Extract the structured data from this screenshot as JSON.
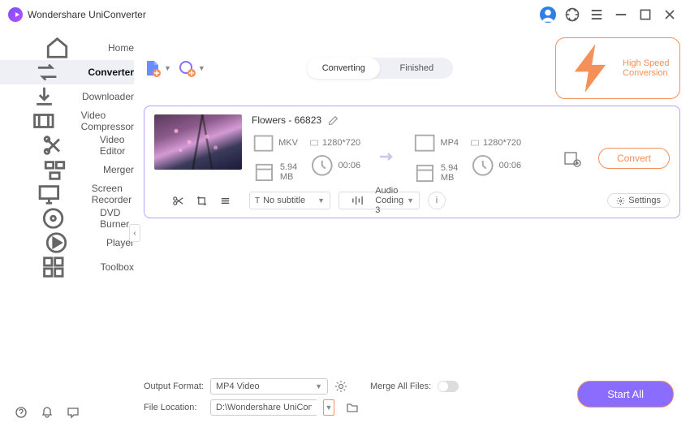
{
  "app": {
    "title": "Wondershare UniConverter"
  },
  "sidebar": {
    "items": [
      {
        "label": "Home",
        "name": "home"
      },
      {
        "label": "Converter",
        "name": "converter"
      },
      {
        "label": "Downloader",
        "name": "downloader"
      },
      {
        "label": "Video Compressor",
        "name": "video-compressor"
      },
      {
        "label": "Video Editor",
        "name": "video-editor"
      },
      {
        "label": "Merger",
        "name": "merger"
      },
      {
        "label": "Screen Recorder",
        "name": "screen-recorder"
      },
      {
        "label": "DVD Burner",
        "name": "dvd-burner"
      },
      {
        "label": "Player",
        "name": "player"
      },
      {
        "label": "Toolbox",
        "name": "toolbox"
      }
    ]
  },
  "tabs": {
    "converting": "Converting",
    "finished": "Finished"
  },
  "speed": "High Speed Conversion",
  "file": {
    "name": "Flowers - 66823",
    "src": {
      "format": "MKV",
      "res": "1280*720",
      "size": "5.94 MB",
      "dur": "00:06"
    },
    "dst": {
      "format": "MP4",
      "res": "1280*720",
      "size": "5.94 MB",
      "dur": "00:06"
    },
    "convert": "Convert",
    "subtitle": "No subtitle",
    "audio": "Audio Coding 3",
    "settings": "Settings"
  },
  "footer": {
    "output_format_label": "Output Format:",
    "output_format_value": "MP4 Video",
    "file_location_label": "File Location:",
    "file_location_value": "D:\\Wondershare UniConverter",
    "merge_label": "Merge All Files:",
    "start_all": "Start All"
  }
}
